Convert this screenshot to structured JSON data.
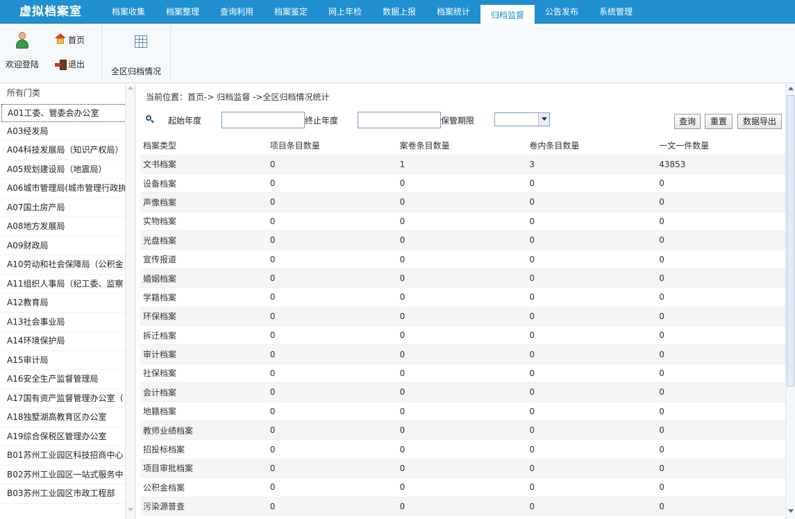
{
  "app_title": "虚拟档案室",
  "nav": {
    "items": [
      "档案收集",
      "档案整理",
      "查询利用",
      "档案鉴定",
      "网上年检",
      "数据上报",
      "档案统计",
      "归档监督",
      "公告发布",
      "系统管理"
    ],
    "active": "归档监督"
  },
  "toolbar": {
    "welcome": "欢迎登陆",
    "home": "首页",
    "exit": "退出",
    "report": "全区归档情况"
  },
  "sidebar": {
    "items": [
      "所有门类",
      "A01工委、管委会办公室",
      "A03经发局",
      "A04科技发展局（知识产权局）",
      "A05规划建设局（地震局）",
      "A06城市管理局(城市管理行政执",
      "A07国土房产局",
      "A08地方发展局",
      "A09财政局",
      "A10劳动和社会保障局（公积金",
      "A11组织人事局（纪工委、监察",
      "A12教育局",
      "A13社会事业局",
      "A14环境保护局",
      "A15审计局",
      "A16安全生产监督管理局",
      "A17国有资产监督管理办公室（",
      "A18独墅湖高教育区办公室",
      "A19综合保税区管理办公室",
      "B01苏州工业园区科技招商中心",
      "B02苏州工业园区一站式服务中",
      "B03苏州工业园区市政工程部"
    ],
    "selected": 1
  },
  "main": {
    "breadcrumb": "当前位置：首页-> 归档监督 ->全区归档情况统计",
    "filters": {
      "start_year_label": "起始年度",
      "start_year_value": "",
      "end_year_label": "终止年度",
      "end_year_value": "",
      "retention_label": "保管期限",
      "retention_value": ""
    },
    "buttons": {
      "query": "查询",
      "reset": "重置",
      "export": "数据导出"
    },
    "table": {
      "headers": [
        "档案类型",
        "项目条目数量",
        "案卷条目数量",
        "卷内条目数量",
        "一文一件数量"
      ],
      "rows": [
        [
          "文书档案",
          "0",
          "1",
          "3",
          "43853"
        ],
        [
          "设备档案",
          "0",
          "0",
          "0",
          "0"
        ],
        [
          "声像档案",
          "0",
          "0",
          "0",
          "0"
        ],
        [
          "实物档案",
          "0",
          "0",
          "0",
          "0"
        ],
        [
          "光盘档案",
          "0",
          "0",
          "0",
          "0"
        ],
        [
          "宣传报道",
          "0",
          "0",
          "0",
          "0"
        ],
        [
          "婚姻档案",
          "0",
          "0",
          "0",
          "0"
        ],
        [
          "学籍档案",
          "0",
          "0",
          "0",
          "0"
        ],
        [
          "环保档案",
          "0",
          "0",
          "0",
          "0"
        ],
        [
          "拆迁档案",
          "0",
          "0",
          "0",
          "0"
        ],
        [
          "审计档案",
          "0",
          "0",
          "0",
          "0"
        ],
        [
          "社保档案",
          "0",
          "0",
          "0",
          "0"
        ],
        [
          "会计档案",
          "0",
          "0",
          "0",
          "0"
        ],
        [
          "地籍档案",
          "0",
          "0",
          "0",
          "0"
        ],
        [
          "教师业绩档案",
          "0",
          "0",
          "0",
          "0"
        ],
        [
          "招投标档案",
          "0",
          "0",
          "0",
          "0"
        ],
        [
          "项目审批档案",
          "0",
          "0",
          "0",
          "0"
        ],
        [
          "公积金档案",
          "0",
          "0",
          "0",
          "0"
        ],
        [
          "污染源普查",
          "0",
          "0",
          "0",
          "0"
        ]
      ]
    }
  },
  "colors": {
    "topbar": "#1f8fd0",
    "active_tab_text": "#1f8fd0",
    "row_alt": "#f5f5f5"
  }
}
